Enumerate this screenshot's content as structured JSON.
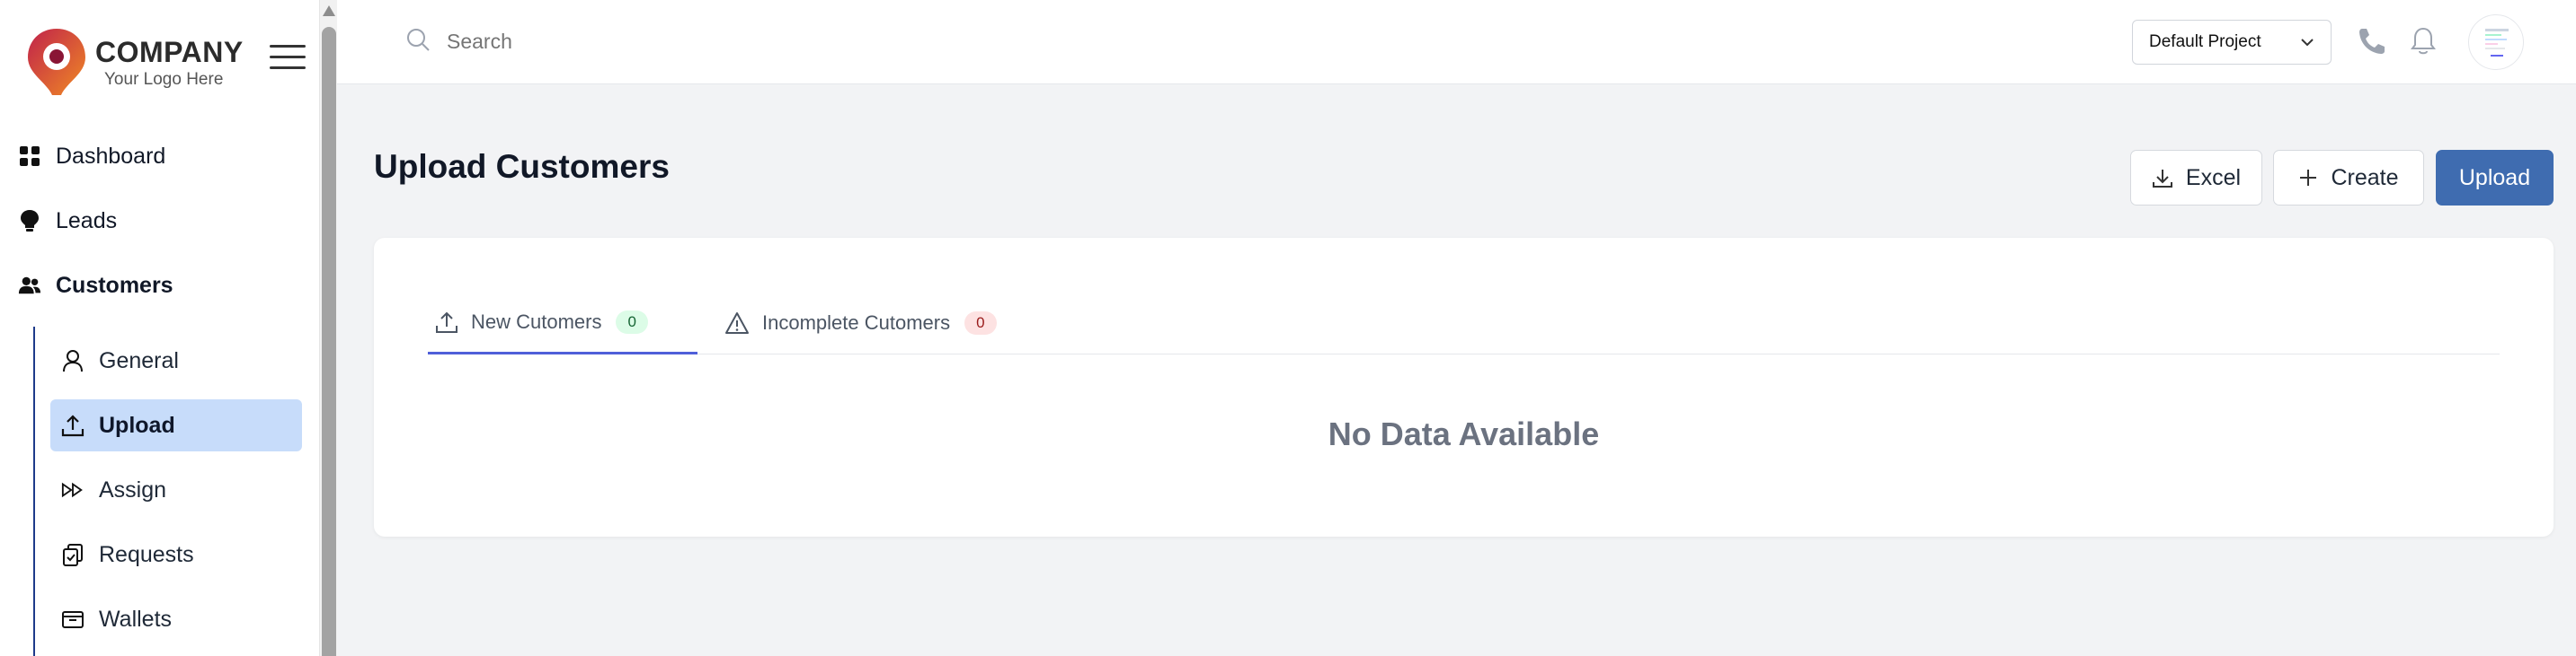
{
  "brand": {
    "name": "COMPANY",
    "tagline": "Your Logo Here"
  },
  "sidebar": {
    "items": [
      {
        "label": "Dashboard",
        "icon": "dashboard-icon"
      },
      {
        "label": "Leads",
        "icon": "bulb-icon"
      },
      {
        "label": "Customers",
        "icon": "users-icon"
      }
    ],
    "submenu": [
      {
        "label": "General",
        "icon": "user-icon"
      },
      {
        "label": "Upload",
        "icon": "upload-icon",
        "active": true
      },
      {
        "label": "Assign",
        "icon": "forward-icon"
      },
      {
        "label": "Requests",
        "icon": "clipboard-icon"
      },
      {
        "label": "Wallets",
        "icon": "wallet-icon"
      }
    ]
  },
  "topbar": {
    "search_placeholder": "Search",
    "project": "Default Project"
  },
  "page": {
    "title": "Upload Customers",
    "buttons": {
      "excel": "Excel",
      "create": "Create",
      "upload": "Upload"
    }
  },
  "tabs": [
    {
      "label": "New Cutomers",
      "count": "0",
      "active": true
    },
    {
      "label": "Incomplete Cutomers",
      "count": "0",
      "active": false
    }
  ],
  "empty_message": "No Data Available",
  "colors": {
    "primary": "#3f6cb0",
    "active_bg": "#c7dcfa",
    "tab_underline": "#4f5fd9"
  }
}
